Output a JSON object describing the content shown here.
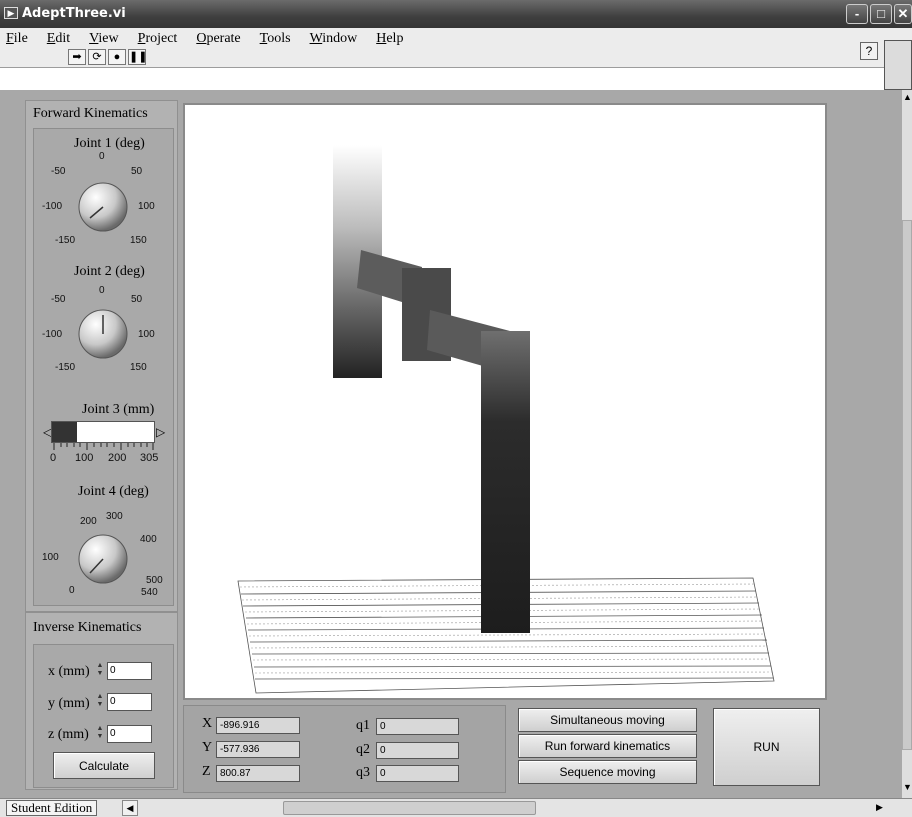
{
  "window": {
    "title": "AdeptThree.vi",
    "icon": "labview-vi-icon"
  },
  "menu": [
    "File",
    "Edit",
    "View",
    "Project",
    "Operate",
    "Tools",
    "Window",
    "Help"
  ],
  "toolbar": {
    "run": "run-arrow-icon",
    "run_continuous": "run-continuously-icon",
    "abort": "abort-icon",
    "pause": "pause-icon",
    "help": "?"
  },
  "forward_kinematics": {
    "title": "Forward Kinematics",
    "joint1": {
      "label": "Joint 1 (deg)",
      "ticks": [
        "-50",
        "0",
        "50",
        "-100",
        "100",
        "-150",
        "150"
      ],
      "value": -150
    },
    "joint2": {
      "label": "Joint 2 (deg)",
      "ticks": [
        "-50",
        "0",
        "50",
        "-100",
        "100",
        "-150",
        "150"
      ],
      "value": 0
    },
    "joint3": {
      "label": "Joint 3 (mm)",
      "ticks": [
        "0",
        "100",
        "200",
        "305"
      ],
      "value": 75
    },
    "joint4": {
      "label": "Joint 4 (deg)",
      "ticks": [
        "200",
        "300",
        "400",
        "100",
        "500",
        "0",
        "540"
      ],
      "value": 0
    }
  },
  "inverse_kinematics": {
    "title": "Inverse Kinematics",
    "x": {
      "label": "x (mm)",
      "value": "0"
    },
    "y": {
      "label": "y (mm)",
      "value": "0"
    },
    "z": {
      "label": "z (mm)",
      "value": "0"
    },
    "calculate": "Calculate"
  },
  "coordinates": {
    "X": {
      "label": "X",
      "value": "-896.916"
    },
    "Y": {
      "label": "Y",
      "value": "-577.936"
    },
    "Z": {
      "label": "Z",
      "value": "800.87"
    },
    "q1": {
      "label": "q1",
      "value": "0"
    },
    "q2": {
      "label": "q2",
      "value": "0"
    },
    "q3": {
      "label": "q3",
      "value": "0"
    }
  },
  "buttons": {
    "simultaneous": "Simultaneous moving",
    "forward": "Run forward kinematics",
    "sequence": "Sequence moving",
    "run": "RUN"
  },
  "status": {
    "edition": "Student Edition"
  }
}
